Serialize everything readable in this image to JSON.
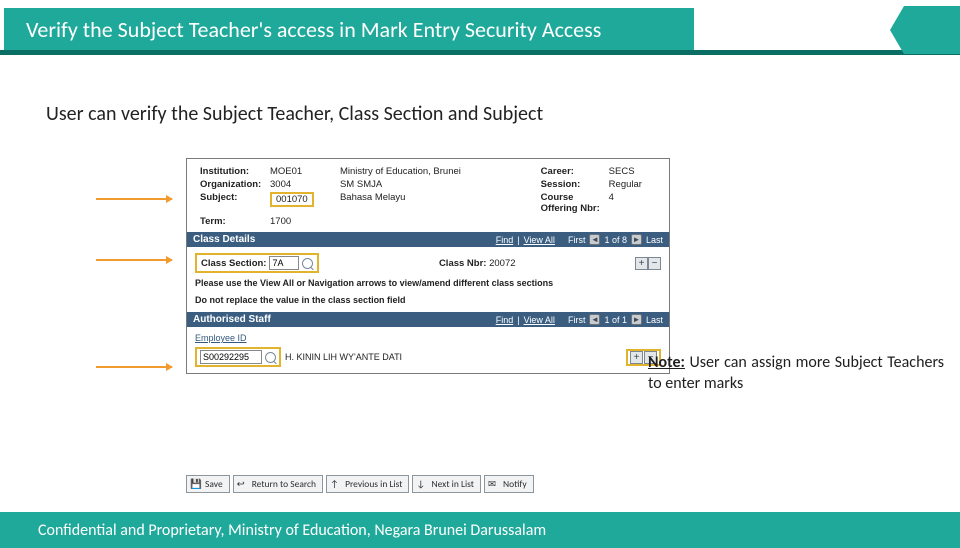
{
  "title": "Verify the Subject Teacher's access in Mark Entry Security Access",
  "subhead": "User can verify the Subject Teacher, Class Section and Subject",
  "meta": {
    "institution_lbl": "Institution:",
    "institution_code": "MOE01",
    "institution_name": "Ministry of Education, Brunei",
    "career_lbl": "Career:",
    "career": "SECS",
    "org_lbl": "Organization:",
    "org_code": "3004",
    "org_name": "SM SMJA",
    "session_lbl": "Session:",
    "session": "Regular",
    "subject_lbl": "Subject:",
    "subject_code": "001070",
    "subject_name": "Bahasa Melayu",
    "offer_lbl": "Course Offering Nbr:",
    "offer": "4",
    "term_lbl": "Term:",
    "term": "1700"
  },
  "cd": {
    "bar": "Class Details",
    "nav_find": "Find",
    "nav_view": "View All",
    "nav_first": "First",
    "nav_pos": "1 of 8",
    "nav_last": "Last",
    "cs_lbl": "Class Section:",
    "cs_val": "7A",
    "cn_lbl": "Class Nbr:",
    "cn_val": "20072",
    "help1": "Please use the View All or Navigation arrows to view/amend different class sections",
    "help2": "Do not replace the value in the class section field"
  },
  "as": {
    "bar": "Authorised Staff",
    "nav_find": "Find",
    "nav_view": "View All",
    "nav_first": "First",
    "nav_pos": "1 of 1",
    "nav_last": "Last",
    "id_head": "Employee ID",
    "id_val": "S00292295",
    "name": "H. KININ LIH WY'ANTE DATI"
  },
  "note_label": "Note:",
  "note_rest": " User can assign more Subject Teachers to enter marks",
  "buttons": {
    "save": "Save",
    "return": "Return to Search",
    "prev": "Previous in List",
    "next": "Next in List",
    "notify": "Notify"
  },
  "footer": "Confidential and Proprietary, Ministry of Education, Negara Brunei Darussalam"
}
